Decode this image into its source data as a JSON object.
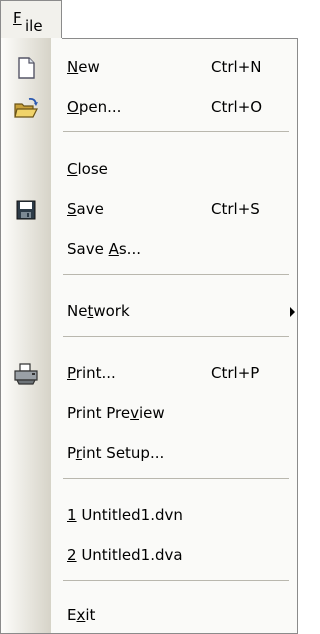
{
  "menubar": {
    "file_pre": "",
    "file_mn": "F",
    "file_post": "ile"
  },
  "menu": {
    "new": {
      "pre": "",
      "mn": "N",
      "post": "ew",
      "shortcut": "Ctrl+N"
    },
    "open": {
      "pre": "",
      "mn": "O",
      "post": "pen...",
      "shortcut": "Ctrl+O"
    },
    "close": {
      "pre": "",
      "mn": "C",
      "post": "lose"
    },
    "save": {
      "pre": "",
      "mn": "S",
      "post": "ave",
      "shortcut": "Ctrl+S"
    },
    "save_as": {
      "pre": "Save ",
      "mn": "A",
      "post": "s..."
    },
    "network": {
      "pre": "Ne",
      "mn": "t",
      "post": "work"
    },
    "print": {
      "pre": "",
      "mn": "P",
      "post": "rint...",
      "shortcut": "Ctrl+P"
    },
    "preview": {
      "pre": "Print Pre",
      "mn": "v",
      "post": "iew"
    },
    "setup": {
      "pre": "P",
      "mn": "r",
      "post": "int Setup..."
    },
    "recent1": {
      "pre": "",
      "mn": "1",
      "post": " Untitled1.dvn"
    },
    "recent2": {
      "pre": "",
      "mn": "2",
      "post": " Untitled1.dva"
    },
    "exit": {
      "pre": "E",
      "mn": "x",
      "post": "it"
    }
  },
  "icons": {
    "new": "new-document-icon",
    "open": "open-folder-icon",
    "save": "floppy-disk-icon",
    "print": "printer-icon",
    "submenu": "submenu-arrow-icon"
  }
}
